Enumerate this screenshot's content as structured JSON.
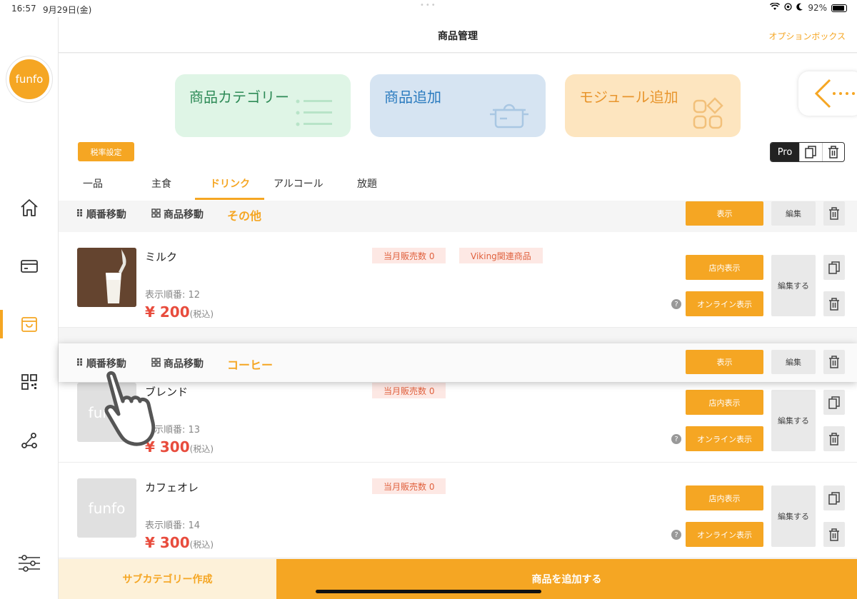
{
  "status": {
    "time": "16:57",
    "date": "9月29日(金)",
    "battery": "92%"
  },
  "sidebar": {
    "logo": "funfo"
  },
  "header": {
    "title": "商品管理",
    "option": "オプションボックス"
  },
  "cards": {
    "category": "商品カテゴリー",
    "add_product": "商品追加",
    "add_module": "モジュール追加"
  },
  "tax_button": "税率設定",
  "pro_label": "Pro",
  "tabs": [
    "一品",
    "主食",
    "ドリンク",
    "アルコール",
    "放題"
  ],
  "active_tab": "ドリンク",
  "category_rows": [
    {
      "drag": "順番移動",
      "move": "商品移動",
      "name": "その他",
      "show": "表示",
      "edit": "編集"
    },
    {
      "drag": "順番移動",
      "move": "商品移動",
      "name": "コーヒー",
      "show": "表示",
      "edit": "編集"
    }
  ],
  "products": [
    {
      "name": "ミルク",
      "order": "表示順番: 12",
      "price": "¥ 200",
      "tax": "(税込)",
      "badges": [
        "当月販売数 0",
        "Viking関連商品"
      ],
      "thumb": "photo"
    },
    {
      "name": "ブレンド",
      "order": "表示順番: 13",
      "price": "¥ 300",
      "tax": "(税込)",
      "badges": [
        "当月販売数 0"
      ],
      "thumb": "funfo"
    },
    {
      "name": "カフェオレ",
      "order": "表示順番: 14",
      "price": "¥ 300",
      "tax": "(税込)",
      "badges": [
        "当月販売数 0"
      ],
      "thumb": "funfo"
    }
  ],
  "product_buttons": {
    "instore": "店内表示",
    "online": "オンライン表示",
    "edit": "編集する",
    "help": "?"
  },
  "bottom": {
    "sub_category": "サブカテゴリー作成",
    "add_product": "商品を追加する"
  },
  "colors": {
    "accent": "#f5a623",
    "price": "#e84c3d",
    "badge_bg": "#fde8e4",
    "badge_text": "#e0613e"
  }
}
